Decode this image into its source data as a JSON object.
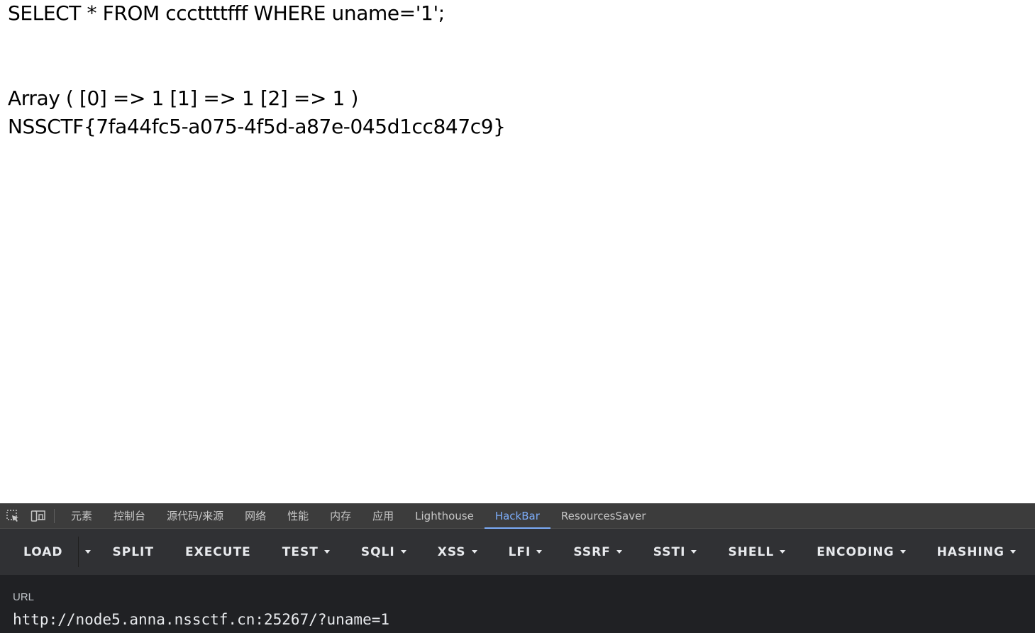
{
  "page": {
    "query_line": "SELECT * FROM cccttttfff WHERE uname='1';",
    "array_line": "Array ( [0] => 1 [1] => 1 [2] => 1 )",
    "flag_line": "NSSCTF{7fa44fc5-a075-4f5d-a87e-045d1cc847c9}"
  },
  "devtools": {
    "icons": [
      "inspect-element-icon",
      "device-toolbar-icon"
    ],
    "tabs": [
      {
        "label": "元素"
      },
      {
        "label": "控制台"
      },
      {
        "label": "源代码/来源"
      },
      {
        "label": "网络"
      },
      {
        "label": "性能"
      },
      {
        "label": "内存"
      },
      {
        "label": "应用"
      },
      {
        "label": "Lighthouse"
      },
      {
        "label": "HackBar",
        "active": true
      },
      {
        "label": "ResourcesSaver"
      }
    ],
    "colors": {
      "tabbar_bg": "#3c3c3c",
      "active_tab": "#7cacf8",
      "toolbar_bg": "#303134",
      "url_area_bg": "#202124"
    }
  },
  "hackbar": {
    "buttons": {
      "load": "LOAD",
      "split": "SPLIT",
      "execute": "EXECUTE",
      "test": "TEST",
      "sqli": "SQLI",
      "xss": "XSS",
      "lfi": "LFI",
      "ssrf": "SSRF",
      "ssti": "SSTI",
      "shell": "SHELL",
      "encoding": "ENCODING",
      "hashing": "HASHING"
    },
    "url_label": "URL",
    "url_value": "http://node5.anna.nssctf.cn:25267/?uname=1"
  }
}
